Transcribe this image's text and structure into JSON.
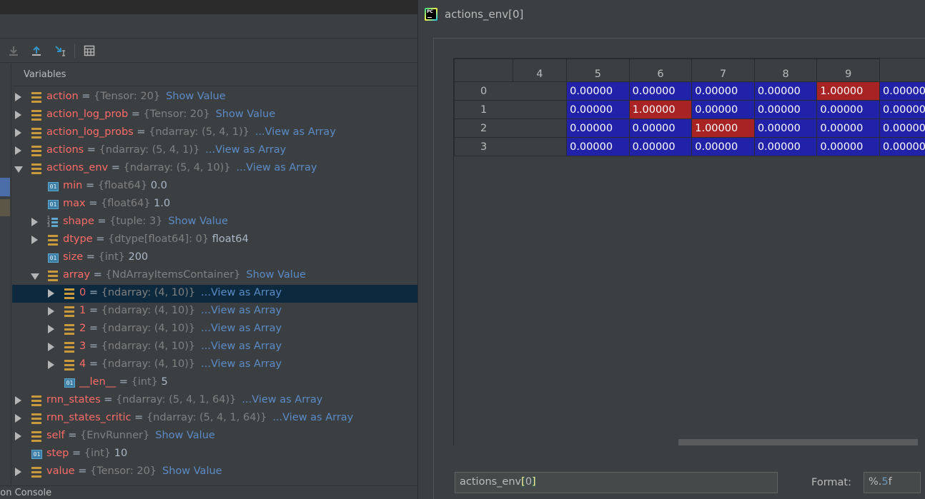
{
  "variables_panel": {
    "header": "Variables",
    "console_tab": "hon Console",
    "rows": [
      {
        "name": "action",
        "eq": " = ",
        "type": "{Tensor: 20}",
        "value": "",
        "link": "Show Value"
      },
      {
        "name": "action_log_prob",
        "eq": " = ",
        "type": "{Tensor: 20}",
        "value": "",
        "link": "Show Value"
      },
      {
        "name": "action_log_probs",
        "eq": " = ",
        "type": "{ndarray: (5, 4, 1)}",
        "value": "",
        "link": "...View as Array"
      },
      {
        "name": "actions",
        "eq": " = ",
        "type": "{ndarray: (5, 4, 1)}",
        "value": "",
        "link": "...View as Array"
      },
      {
        "name": "actions_env",
        "eq": " = ",
        "type": "{ndarray: (5, 4, 10)}",
        "value": "",
        "link": "...View as Array"
      },
      {
        "name": "min",
        "eq": " = ",
        "type": "{float64}",
        "value": " 0.0",
        "link": ""
      },
      {
        "name": "max",
        "eq": " = ",
        "type": "{float64}",
        "value": " 1.0",
        "link": ""
      },
      {
        "name": "shape",
        "eq": " = ",
        "type": "{tuple: 3}",
        "value": "",
        "link": "Show Value"
      },
      {
        "name": "dtype",
        "eq": " = ",
        "type": "{dtype[float64]: 0}",
        "value": " float64",
        "link": ""
      },
      {
        "name": "size",
        "eq": " = ",
        "type": "{int}",
        "value": " 200",
        "link": ""
      },
      {
        "name": "array",
        "eq": " = ",
        "type": "{NdArrayItemsContainer}",
        "value": "",
        "link": "Show Value"
      },
      {
        "name": "0",
        "eq": " = ",
        "type": "{ndarray: (4, 10)}",
        "value": "",
        "link": "...View as Array"
      },
      {
        "name": "1",
        "eq": " = ",
        "type": "{ndarray: (4, 10)}",
        "value": "",
        "link": "...View as Array"
      },
      {
        "name": "2",
        "eq": " = ",
        "type": "{ndarray: (4, 10)}",
        "value": "",
        "link": "...View as Array"
      },
      {
        "name": "3",
        "eq": " = ",
        "type": "{ndarray: (4, 10)}",
        "value": "",
        "link": "...View as Array"
      },
      {
        "name": "4",
        "eq": " = ",
        "type": "{ndarray: (4, 10)}",
        "value": "",
        "link": "...View as Array"
      },
      {
        "name": "__len__",
        "eq": " = ",
        "type": "{int}",
        "value": " 5",
        "link": ""
      },
      {
        "name": "rnn_states",
        "eq": " = ",
        "type": "{ndarray: (5, 4, 1, 64)}",
        "value": "",
        "link": "...View as Array"
      },
      {
        "name": "rnn_states_critic",
        "eq": " = ",
        "type": "{ndarray: (5, 4, 1, 64)}",
        "value": "",
        "link": "...View as Array"
      },
      {
        "name": "self",
        "eq": " = ",
        "type": "{EnvRunner}",
        "value": "",
        "link": "Show Value"
      },
      {
        "name": "step",
        "eq": " = ",
        "type": "{int}",
        "value": " 10",
        "link": ""
      },
      {
        "name": "value",
        "eq": " = ",
        "type": "{Tensor: 20}",
        "value": "",
        "link": "Show Value"
      }
    ]
  },
  "viewer": {
    "app_icon_text": "PC",
    "title": "actions_env[0]",
    "columns": [
      "4",
      "5",
      "6",
      "7",
      "8",
      "9"
    ],
    "rows": [
      {
        "label": "0",
        "cells": [
          "0.00000",
          "0.00000",
          "0.00000",
          "0.00000",
          "1.00000",
          "0.00000"
        ]
      },
      {
        "label": "1",
        "cells": [
          "0.00000",
          "1.00000",
          "0.00000",
          "0.00000",
          "0.00000",
          "0.00000"
        ]
      },
      {
        "label": "2",
        "cells": [
          "0.00000",
          "0.00000",
          "1.00000",
          "0.00000",
          "0.00000",
          "0.00000"
        ]
      },
      {
        "label": "3",
        "cells": [
          "0.00000",
          "0.00000",
          "0.00000",
          "0.00000",
          "0.00000",
          "0.00000"
        ]
      }
    ],
    "expression": {
      "prefix": "actions_env",
      "bracket_open": "[",
      "index": "0",
      "bracket_close": "]"
    },
    "format_label": "Format:",
    "format": {
      "pre": "%.",
      "num": "5",
      "post": "f"
    }
  },
  "colors": {
    "low_cell": "#2222a8",
    "high_cell": "#a82323",
    "link": "#5a8bc7",
    "var_name": "#ff6b68"
  }
}
